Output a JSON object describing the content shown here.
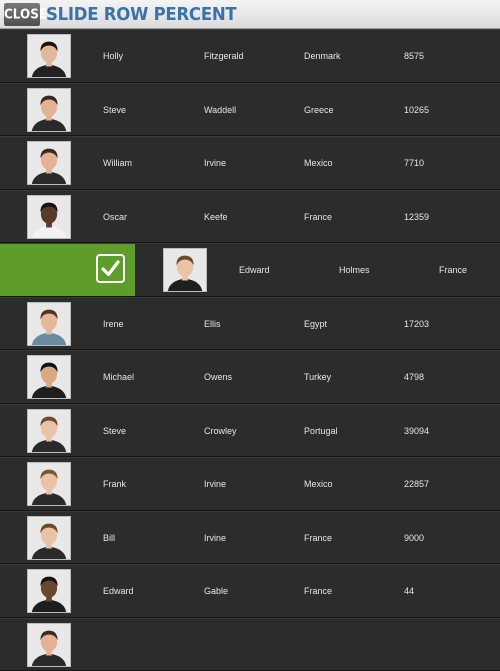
{
  "header": {
    "close_label": "CLOSE",
    "title": "SLIDE ROW PERCENT"
  },
  "rows": [
    {
      "first": "Holly",
      "last": "Fitzgerald",
      "country": "Denmark",
      "number": "8575",
      "hair": "#1a1411",
      "skin": "#e2b89a",
      "suit": "#222"
    },
    {
      "first": "Steve",
      "last": "Waddell",
      "country": "Greece",
      "number": "10265",
      "hair": "#3a2a20",
      "skin": "#e4b293",
      "suit": "#2a2a2a"
    },
    {
      "first": "William",
      "last": "Irvine",
      "country": "Mexico",
      "number": "7710",
      "hair": "#3a2a20",
      "skin": "#e4b293",
      "suit": "#2a2a2a"
    },
    {
      "first": "Oscar",
      "last": "Keefe",
      "country": "France",
      "number": "12359",
      "hair": "#1a1210",
      "skin": "#5a3a28",
      "suit": "#f2f2f2"
    },
    {
      "first": "Edward",
      "last": "Holmes",
      "country": "France",
      "number": "",
      "hair": "#6b4a2e",
      "skin": "#eac3a6",
      "suit": "#1f1f1f",
      "swiped": true
    },
    {
      "first": "Irene",
      "last": "Ellis",
      "country": "Egypt",
      "number": "17203",
      "hair": "#5a3320",
      "skin": "#e5b899",
      "suit": "#6a8aa0"
    },
    {
      "first": "Michael",
      "last": "Owens",
      "country": "Turkey",
      "number": "4798",
      "hair": "#111",
      "skin": "#d9a984",
      "suit": "#1e1e1e"
    },
    {
      "first": "Steve",
      "last": "Crowley",
      "country": "Portugal",
      "number": "39094",
      "hair": "#6b4a2e",
      "skin": "#eac3a6",
      "suit": "#2a2a2a"
    },
    {
      "first": "Frank",
      "last": "Irvine",
      "country": "Mexico",
      "number": "22857",
      "hair": "#7a5634",
      "skin": "#eac3a6",
      "suit": "#2a2a2a"
    },
    {
      "first": "Bill",
      "last": "Irvine",
      "country": "France",
      "number": "9000",
      "hair": "#6b4a2e",
      "skin": "#eac3a6",
      "suit": "#2a2a2a"
    },
    {
      "first": "Edward",
      "last": "Gable",
      "country": "France",
      "number": "44",
      "hair": "#1a1210",
      "skin": "#6a4530",
      "suit": "#1e1e1e"
    },
    {
      "first": "",
      "last": "",
      "country": "",
      "number": "",
      "hair": "#3a2a20",
      "skin": "#e4b293",
      "suit": "#2a2a2a"
    }
  ],
  "icons": {
    "check": "checkmark-icon"
  }
}
